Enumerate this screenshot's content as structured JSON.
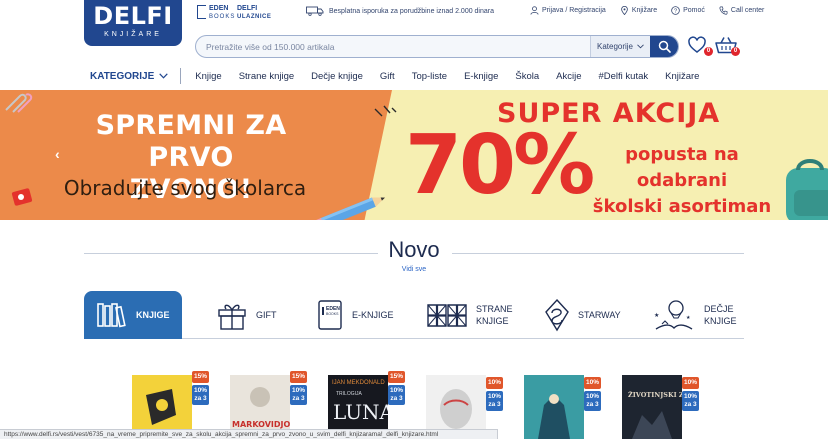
{
  "header": {
    "logo_main": "DELFI",
    "logo_sub": "KNJIŽARE",
    "eden_title": "EDEN",
    "eden_sub": "BOOKS",
    "ulaz_title": "DELFI",
    "ulaz_sub": "ULAZNICE",
    "shipping": "Besplatna isporuka za porudžbine iznad 2.000 dinara",
    "links": [
      "Prijava / Registracija",
      "Knjižare",
      "Pomoć",
      "Call center"
    ]
  },
  "search": {
    "placeholder": "Pretražite više od 150.000 artikala",
    "category": "Kategorije"
  },
  "badges": {
    "wishlist": "0",
    "cart": "0"
  },
  "nav": {
    "categories": "KATEGORIJE",
    "items": [
      "Knjige",
      "Strane knjige",
      "Dečje knjige",
      "Gift",
      "Top-liste",
      "E-knjige",
      "Škola",
      "Akcije",
      "#Delfi kutak",
      "Knjižare"
    ]
  },
  "banner": {
    "left_line1": "SPREMNI ZA",
    "left_line2": "PRVO ZVONO!",
    "left_line3": "Obradujte svog školarca",
    "headline": "SUPER AKCIJA",
    "percent": "70%",
    "desc_line1": "popusta na odabrani",
    "desc_line2": "školski asortiman",
    "colors": {
      "orange": "#ec8a4a",
      "yellow": "#f6efb2",
      "red": "#e4322c"
    }
  },
  "novo": {
    "title": "Novo",
    "see_all": "Vidi sve",
    "tabs": [
      {
        "label": "KNJIGE",
        "icon": "books-icon"
      },
      {
        "label": "GIFT",
        "icon": "gift-icon"
      },
      {
        "label": "E-KNJIGE",
        "icon": "ebook-icon"
      },
      {
        "label": "STRANE\nKNJIGE",
        "line1": "STRANE",
        "line2": "KNJIGE",
        "icon": "uk-book-icon"
      },
      {
        "label": "STARWAY",
        "icon": "starway-icon"
      },
      {
        "label": "DEČJE\nKNJIGE",
        "line1": "DEČJE",
        "line2": "KNJIGE",
        "icon": "kids-icon"
      }
    ]
  },
  "products": [
    {
      "discount": "15%",
      "extra": "10%",
      "extra2": "za 3"
    },
    {
      "discount": "15%",
      "extra": "10%",
      "extra2": "za 3",
      "cover_text": "MARKOVIDJOKOVIĆ"
    },
    {
      "discount": "15%",
      "extra": "10%",
      "extra2": "za 3",
      "cover_text": "LUNA",
      "author": "IJAN MEKDONALD",
      "sub": "TRILOGIJA"
    },
    {
      "discount": "10%",
      "extra": "10%",
      "extra2": "za 3"
    },
    {
      "discount": "10%",
      "extra": "10%",
      "extra2": "za 3"
    },
    {
      "discount": "10%",
      "extra": "10%",
      "extra2": "za 3",
      "cover_text": "ŽIVOTINJSKI ZAMAK"
    }
  ],
  "status_url": "https://www.delfi.rs/vesti/vest/6735_na_vreme_pripremite_sve_za_skolu_akcija_spremni_za_prvo_zvono_u_svim_delfi_knjizarama!_delfi_knjizare.html"
}
